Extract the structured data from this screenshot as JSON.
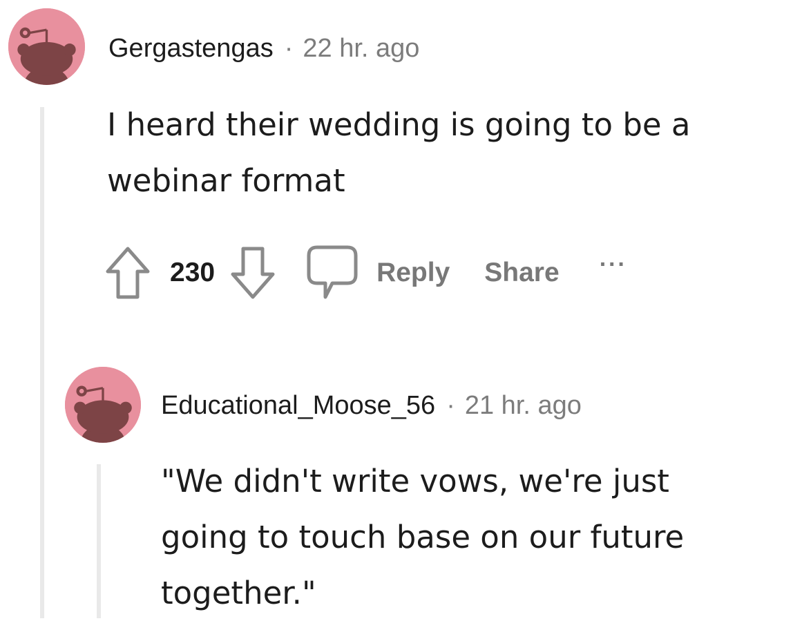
{
  "comment": {
    "username": "Gergastengas",
    "separator": "·",
    "time": "22 hr. ago",
    "body_lines": [
      "I heard their wedding is going to be a",
      "webinar format"
    ],
    "avatar_icon": "reddit-snoo-avatar-icon",
    "avatar_color": "#e8909e",
    "actions": {
      "upvote_icon": "upvote-arrow-icon",
      "vote_count": "230",
      "downvote_icon": "downvote-arrow-icon",
      "comment_icon": "speech-bubble-icon",
      "reply_label": "Reply",
      "share_label": "Share",
      "more_label": "···"
    }
  },
  "reply": {
    "username": "Educational_Moose_56",
    "separator": "·",
    "time": "21 hr. ago",
    "body_lines": [
      "\"We didn't write vows, we're just",
      "going to touch base on our future",
      "together.\""
    ],
    "avatar_icon": "reddit-snoo-avatar-icon",
    "avatar_color": "#e8909e"
  },
  "colors": {
    "text": "#1c1c1c",
    "muted": "#7c7c7c",
    "thread_line": "#e9e9e9"
  }
}
